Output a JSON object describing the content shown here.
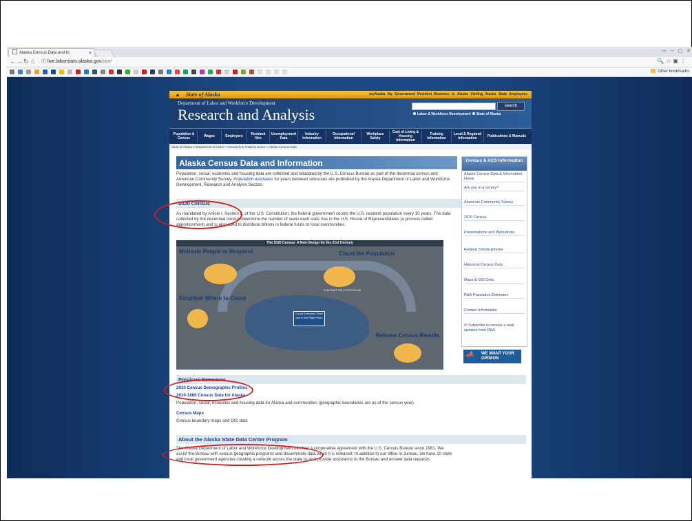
{
  "browser": {
    "tab_title": "Alaska Census Data and In",
    "tab_close": "×",
    "url_host": "live.laborstats.alaska.gov",
    "url_path": "/cen/",
    "other_bookmarks": "Other bookmarks",
    "window_controls": "▭ ─ ▢ ✕"
  },
  "site": {
    "state_label": "State of Alaska",
    "top_links": "myAlaska  My Government  Resident  Business in Alaska  Visiting Alaska  State Employees",
    "department": "Department of Labor and Workforce Development",
    "banner_title": "Research and Analysis",
    "search_button": "search",
    "radio_option_1": "Labor & Workforce Development",
    "radio_option_2": "State of Alaska",
    "nav": [
      {
        "label": "Population & Census"
      },
      {
        "label": "Wages"
      },
      {
        "label": "Employers"
      },
      {
        "label": "Resident Hire"
      },
      {
        "label": "Unemployment Data"
      },
      {
        "label": "Industry Information"
      },
      {
        "label": "Occupational Information"
      },
      {
        "label": "Workplace Safety"
      },
      {
        "label": "Cost of Living & Housing Information"
      },
      {
        "label": "Training Information"
      },
      {
        "label": "Local & Regional Information"
      },
      {
        "label": "Publications & Manuals"
      }
    ],
    "breadcrumb": "State of Alaska > Department of Labor > Research & Analysis Home > Alaska Census Data"
  },
  "main": {
    "title": "Alaska Census Data and Information",
    "intro_before": "Population, social, economic and housing data are collected and tabulated by the U.S. Census Bureau as part of the decennial census and American Community Survey.",
    "intro_link": "Population estimates",
    "intro_after": "for years between censuses are published by the Alaska Department of Labor and Workforce Development, Research and Analysis Section.",
    "census2020_heading": "2020 Census",
    "census2020_text": "As mandated by Article I, Section 2, of the U.S. Constitution, the federal government counts the U.S. resident population every 10 years. The data collected by the decennial census determine the number of seats each state has in the U.S. House of Representatives (a process called apportionment) and is also used to distribute billions in federal funds to local communities.",
    "infographic": {
      "title": "The 2020 Census: A New Design for the 21st Century",
      "motivate": "Motivate People to Respond",
      "establish": "Establish Where to Count",
      "count": "Count the Population",
      "release": "Release Census Results",
      "map_label": "Count Everyone Once and in the Right Place",
      "internet": "INTERNET SELF-RESPONSE"
    },
    "previous_heading": "Previous Censuses",
    "profiles_link": "2010 Census Demographic Profiles",
    "historic_link": "2010-1880 Census Data for Alaska",
    "historic_desc": "Population, social, economic and housing data for Alaska and communities (geographic boundaries are as of the census year)",
    "maps_link": "Census Maps",
    "maps_desc": "Census boundary maps and GIS data",
    "about_heading": "About the Alaska State Data Center Program",
    "about_text": "The Alaska Department of Labor and Workforce Development has had a cooperative agreement with the U.S. Census Bureau since 1981. We assist the Bureau with census geographic programs and disseminate data when it is released. In addition to our office in Juneau, we have 10 state and local government agencies creating a network across the state to also provide assistance to the Bureau and answer data requests"
  },
  "sidebar": {
    "title": "Census & ACS Information",
    "items": [
      {
        "label": "Alaska Census Data & Information Home"
      },
      {
        "label": "Are you in a survey?"
      },
      {
        "label": "American Community Survey"
      },
      {
        "label": "2020 Census"
      },
      {
        "label": "Presentations and Workshops"
      },
      {
        "label": "Related Trends Articles"
      },
      {
        "label": "Historical Census Data"
      },
      {
        "label": "Maps & GIS Data"
      },
      {
        "label": "R&A Population Estimates"
      },
      {
        "label": "Contact Information"
      },
      {
        "label": "Subscribe to receive e-mail updates from R&A"
      }
    ],
    "opinion": "WE WANT YOUR OPINION"
  }
}
